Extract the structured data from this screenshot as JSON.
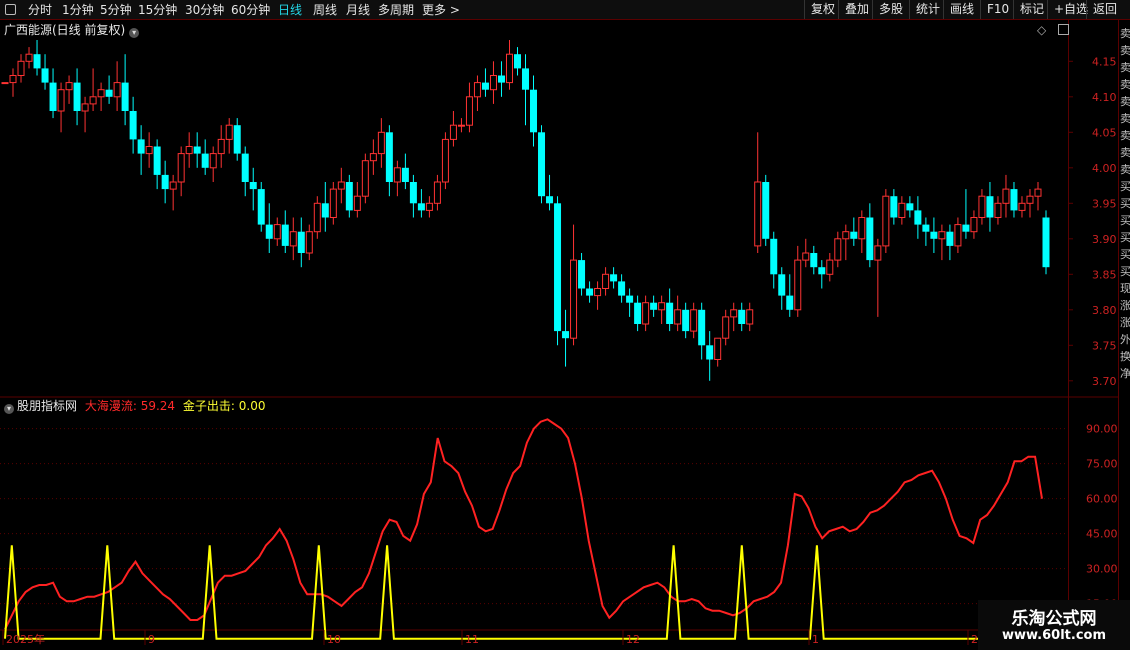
{
  "toolbar": {
    "periods": [
      "分时",
      "1分钟",
      "5分钟",
      "15分钟",
      "30分钟",
      "60分钟",
      "日线",
      "周线",
      "月线",
      "多周期",
      "更多 >"
    ],
    "active_period": "日线",
    "buttons": [
      "复权",
      "叠加",
      "多股",
      "统计",
      "画线",
      "F10",
      "标记",
      "+自选",
      "返回"
    ]
  },
  "price_panel": {
    "title": "广西能源(日线 前复权)",
    "y_ticks": [
      "4.15",
      "4.10",
      "4.05",
      "4.00",
      "3.95",
      "3.90",
      "3.85",
      "3.80",
      "3.75",
      "3.70"
    ]
  },
  "indicator_panel": {
    "name": "股朋指标网",
    "label1": "大海漫流: 59.24",
    "label2": "金子出击: 0.00",
    "y_ticks": [
      "90.00",
      "75.00",
      "60.00",
      "45.00",
      "30.00",
      "15.00"
    ]
  },
  "x_axis": [
    "2025年",
    "9",
    "10",
    "11",
    "12",
    "1",
    "2"
  ],
  "sidebar_chars": [
    "卖",
    "卖",
    "卖",
    "卖",
    "卖",
    "卖",
    "卖",
    "卖",
    "卖",
    "买",
    "买",
    "买",
    "买",
    "买",
    "买",
    "现",
    "涨",
    "涨",
    "外",
    "换",
    "净"
  ],
  "watermark": {
    "line1": "乐淘公式网",
    "line2": "www.60lt.com"
  },
  "colors": {
    "up": "#ff3333",
    "down": "#00ffff",
    "line1": "#ff2222",
    "line2": "#ffff00",
    "grid": "#5a0000"
  },
  "chart_data": {
    "type": "candlestick",
    "y_unit": "price",
    "ylim": [
      3.68,
      4.18
    ],
    "candles": [
      [
        4.12,
        4.12,
        4.12,
        4.12
      ],
      [
        4.12,
        4.14,
        4.1,
        4.13
      ],
      [
        4.13,
        4.16,
        4.12,
        4.15
      ],
      [
        4.15,
        4.17,
        4.14,
        4.16
      ],
      [
        4.16,
        4.18,
        4.13,
        4.14
      ],
      [
        4.14,
        4.16,
        4.11,
        4.12
      ],
      [
        4.12,
        4.14,
        4.07,
        4.08
      ],
      [
        4.08,
        4.12,
        4.05,
        4.11
      ],
      [
        4.11,
        4.13,
        4.09,
        4.12
      ],
      [
        4.12,
        4.14,
        4.06,
        4.08
      ],
      [
        4.08,
        4.1,
        4.05,
        4.09
      ],
      [
        4.09,
        4.14,
        4.08,
        4.1
      ],
      [
        4.1,
        4.12,
        4.08,
        4.11
      ],
      [
        4.11,
        4.13,
        4.09,
        4.1
      ],
      [
        4.1,
        4.15,
        4.08,
        4.12
      ],
      [
        4.12,
        4.16,
        4.06,
        4.08
      ],
      [
        4.08,
        4.1,
        4.02,
        4.04
      ],
      [
        4.04,
        4.06,
        3.99,
        4.02
      ],
      [
        4.02,
        4.05,
        4.0,
        4.03
      ],
      [
        4.03,
        4.04,
        3.97,
        3.99
      ],
      [
        3.99,
        4.01,
        3.95,
        3.97
      ],
      [
        3.97,
        3.99,
        3.94,
        3.98
      ],
      [
        3.98,
        4.03,
        3.96,
        4.02
      ],
      [
        4.02,
        4.05,
        4.0,
        4.03
      ],
      [
        4.03,
        4.05,
        4.0,
        4.02
      ],
      [
        4.02,
        4.04,
        3.99,
        4.0
      ],
      [
        4.0,
        4.03,
        3.98,
        4.02
      ],
      [
        4.02,
        4.06,
        4.0,
        4.04
      ],
      [
        4.04,
        4.07,
        4.02,
        4.06
      ],
      [
        4.06,
        4.07,
        4.01,
        4.02
      ],
      [
        4.02,
        4.03,
        3.96,
        3.98
      ],
      [
        3.98,
        4.0,
        3.94,
        3.97
      ],
      [
        3.97,
        3.98,
        3.91,
        3.92
      ],
      [
        3.92,
        3.95,
        3.88,
        3.9
      ],
      [
        3.9,
        3.93,
        3.89,
        3.92
      ],
      [
        3.92,
        3.94,
        3.88,
        3.89
      ],
      [
        3.89,
        3.93,
        3.87,
        3.91
      ],
      [
        3.91,
        3.93,
        3.86,
        3.88
      ],
      [
        3.88,
        3.92,
        3.87,
        3.91
      ],
      [
        3.91,
        3.96,
        3.9,
        3.95
      ],
      [
        3.95,
        3.98,
        3.91,
        3.93
      ],
      [
        3.93,
        3.98,
        3.92,
        3.97
      ],
      [
        3.97,
        4.0,
        3.95,
        3.98
      ],
      [
        3.98,
        3.99,
        3.93,
        3.94
      ],
      [
        3.94,
        3.98,
        3.93,
        3.96
      ],
      [
        3.96,
        4.02,
        3.95,
        4.01
      ],
      [
        4.01,
        4.04,
        3.99,
        4.02
      ],
      [
        4.02,
        4.07,
        4.0,
        4.05
      ],
      [
        4.05,
        4.06,
        3.96,
        3.98
      ],
      [
        3.98,
        4.01,
        3.96,
        4.0
      ],
      [
        4.0,
        4.02,
        3.97,
        3.98
      ],
      [
        3.98,
        3.99,
        3.93,
        3.95
      ],
      [
        3.95,
        3.97,
        3.93,
        3.94
      ],
      [
        3.94,
        3.96,
        3.93,
        3.95
      ],
      [
        3.95,
        3.99,
        3.94,
        3.98
      ],
      [
        3.98,
        4.05,
        3.97,
        4.04
      ],
      [
        4.04,
        4.08,
        4.03,
        4.06
      ],
      [
        4.06,
        4.07,
        4.05,
        4.06
      ],
      [
        4.06,
        4.12,
        4.05,
        4.1
      ],
      [
        4.1,
        4.13,
        4.08,
        4.12
      ],
      [
        4.12,
        4.14,
        4.1,
        4.11
      ],
      [
        4.11,
        4.15,
        4.09,
        4.13
      ],
      [
        4.13,
        4.15,
        4.1,
        4.12
      ],
      [
        4.12,
        4.18,
        4.11,
        4.16
      ],
      [
        4.16,
        4.17,
        4.13,
        4.14
      ],
      [
        4.14,
        4.16,
        4.06,
        4.11
      ],
      [
        4.11,
        4.13,
        4.03,
        4.05
      ],
      [
        4.05,
        4.06,
        3.95,
        3.96
      ],
      [
        3.96,
        3.99,
        3.94,
        3.95
      ],
      [
        3.95,
        3.96,
        3.75,
        3.77
      ],
      [
        3.77,
        3.8,
        3.72,
        3.76
      ],
      [
        3.76,
        3.92,
        3.75,
        3.87
      ],
      [
        3.87,
        3.88,
        3.82,
        3.83
      ],
      [
        3.83,
        3.84,
        3.81,
        3.82
      ],
      [
        3.82,
        3.84,
        3.8,
        3.83
      ],
      [
        3.83,
        3.86,
        3.82,
        3.85
      ],
      [
        3.85,
        3.86,
        3.83,
        3.84
      ],
      [
        3.84,
        3.85,
        3.81,
        3.82
      ],
      [
        3.82,
        3.83,
        3.79,
        3.81
      ],
      [
        3.81,
        3.82,
        3.77,
        3.78
      ],
      [
        3.78,
        3.82,
        3.77,
        3.81
      ],
      [
        3.81,
        3.82,
        3.79,
        3.8
      ],
      [
        3.8,
        3.82,
        3.78,
        3.81
      ],
      [
        3.81,
        3.83,
        3.77,
        3.78
      ],
      [
        3.78,
        3.82,
        3.77,
        3.8
      ],
      [
        3.8,
        3.81,
        3.76,
        3.77
      ],
      [
        3.77,
        3.81,
        3.76,
        3.8
      ],
      [
        3.8,
        3.81,
        3.73,
        3.75
      ],
      [
        3.75,
        3.77,
        3.7,
        3.73
      ],
      [
        3.73,
        3.76,
        3.72,
        3.76
      ],
      [
        3.76,
        3.8,
        3.75,
        3.79
      ],
      [
        3.79,
        3.81,
        3.77,
        3.8
      ],
      [
        3.8,
        3.81,
        3.77,
        3.78
      ],
      [
        3.78,
        3.81,
        3.77,
        3.8
      ],
      [
        3.89,
        4.05,
        3.88,
        3.98
      ],
      [
        3.98,
        3.99,
        3.89,
        3.9
      ],
      [
        3.9,
        3.91,
        3.83,
        3.85
      ],
      [
        3.85,
        3.86,
        3.8,
        3.82
      ],
      [
        3.82,
        3.85,
        3.79,
        3.8
      ],
      [
        3.8,
        3.89,
        3.79,
        3.87
      ],
      [
        3.87,
        3.9,
        3.86,
        3.88
      ],
      [
        3.88,
        3.89,
        3.85,
        3.86
      ],
      [
        3.86,
        3.87,
        3.83,
        3.85
      ],
      [
        3.85,
        3.88,
        3.84,
        3.87
      ],
      [
        3.87,
        3.91,
        3.86,
        3.9
      ],
      [
        3.9,
        3.92,
        3.87,
        3.91
      ],
      [
        3.91,
        3.93,
        3.89,
        3.9
      ],
      [
        3.9,
        3.94,
        3.88,
        3.93
      ],
      [
        3.93,
        3.95,
        3.86,
        3.87
      ],
      [
        3.87,
        3.9,
        3.79,
        3.89
      ],
      [
        3.89,
        3.97,
        3.88,
        3.96
      ],
      [
        3.96,
        3.97,
        3.92,
        3.93
      ],
      [
        3.93,
        3.96,
        3.92,
        3.95
      ],
      [
        3.95,
        3.96,
        3.93,
        3.94
      ],
      [
        3.94,
        3.96,
        3.9,
        3.92
      ],
      [
        3.92,
        3.93,
        3.89,
        3.91
      ],
      [
        3.91,
        3.93,
        3.88,
        3.9
      ],
      [
        3.9,
        3.92,
        3.87,
        3.91
      ],
      [
        3.91,
        3.92,
        3.87,
        3.89
      ],
      [
        3.89,
        3.93,
        3.88,
        3.92
      ],
      [
        3.92,
        3.97,
        3.9,
        3.91
      ],
      [
        3.91,
        3.94,
        3.9,
        3.93
      ],
      [
        3.93,
        3.97,
        3.92,
        3.96
      ],
      [
        3.96,
        3.98,
        3.91,
        3.93
      ],
      [
        3.93,
        3.96,
        3.92,
        3.95
      ],
      [
        3.95,
        3.99,
        3.93,
        3.97
      ],
      [
        3.97,
        3.98,
        3.93,
        3.94
      ],
      [
        3.94,
        3.96,
        3.93,
        3.95
      ],
      [
        3.95,
        3.97,
        3.93,
        3.96
      ],
      [
        3.96,
        3.98,
        3.94,
        3.97
      ],
      [
        3.93,
        3.94,
        3.85,
        3.86
      ]
    ],
    "series": [
      {
        "name": "大海漫流",
        "values": [
          4,
          10,
          16,
          20,
          22,
          23,
          23,
          24,
          18,
          16,
          16,
          17,
          18,
          18,
          19,
          20,
          22,
          24,
          29,
          33,
          28,
          25,
          22,
          19,
          17,
          14,
          11,
          8,
          8,
          10,
          17,
          24,
          27,
          27,
          28,
          29,
          32,
          35,
          40,
          43,
          47,
          42,
          34,
          24,
          19,
          19,
          19,
          18,
          16,
          14,
          17,
          20,
          22,
          28,
          37,
          46,
          51,
          50,
          44,
          42,
          49,
          62,
          67,
          86,
          76,
          74,
          71,
          63,
          57,
          48,
          46,
          47,
          55,
          64,
          71,
          74,
          84,
          90,
          93,
          94,
          92,
          90,
          86,
          75,
          60,
          42,
          28,
          14,
          9,
          12,
          16,
          18,
          20,
          22,
          23,
          24,
          22,
          18,
          16,
          16,
          17,
          16,
          13,
          12,
          12,
          11,
          10,
          11,
          13,
          16,
          17,
          18,
          20,
          24,
          40,
          62,
          61,
          56,
          48,
          43,
          46,
          47,
          48,
          46,
          47,
          50,
          54,
          55,
          57,
          60,
          63,
          67,
          68,
          70,
          71,
          72,
          67,
          60,
          51,
          44,
          43,
          41,
          51,
          53,
          57,
          62,
          67,
          76,
          76,
          78,
          78,
          60
        ]
      },
      {
        "name": "金子出击",
        "values": [
          0,
          40,
          0,
          0,
          0,
          0,
          0,
          0,
          0,
          0,
          0,
          0,
          0,
          0,
          0,
          40,
          0,
          0,
          0,
          0,
          0,
          0,
          0,
          0,
          0,
          0,
          0,
          0,
          0,
          0,
          40,
          0,
          0,
          0,
          0,
          0,
          0,
          0,
          0,
          0,
          0,
          0,
          0,
          0,
          0,
          0,
          40,
          0,
          0,
          0,
          0,
          0,
          0,
          0,
          0,
          0,
          40,
          0,
          0,
          0,
          0,
          0,
          0,
          0,
          0,
          0,
          0,
          0,
          0,
          0,
          0,
          0,
          0,
          0,
          0,
          0,
          0,
          0,
          0,
          0,
          0,
          0,
          0,
          0,
          0,
          0,
          0,
          0,
          0,
          0,
          0,
          0,
          0,
          0,
          0,
          0,
          0,
          0,
          40,
          0,
          0,
          0,
          0,
          0,
          0,
          0,
          0,
          0,
          40,
          0,
          0,
          0,
          0,
          0,
          0,
          0,
          0,
          0,
          0,
          40,
          0,
          0,
          0,
          0,
          0,
          0,
          0,
          0,
          0,
          0,
          0,
          0,
          0,
          0,
          0,
          0,
          0,
          0,
          0,
          0,
          0,
          0,
          0,
          0,
          0,
          0,
          0,
          0,
          0,
          0,
          0,
          0,
          0
        ]
      }
    ],
    "indicator_ylim": [
      5,
      98
    ]
  }
}
